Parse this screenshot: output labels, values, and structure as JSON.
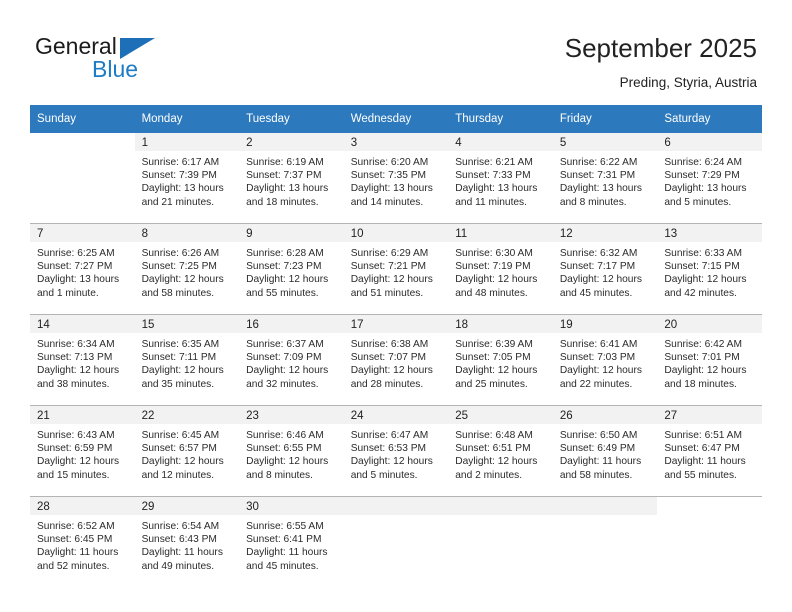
{
  "brand": {
    "name_top": "General",
    "name_bottom": "Blue",
    "triangle_color": "#1d6fb8",
    "blue_text_color": "#1d7cc4"
  },
  "header": {
    "title": "September 2025",
    "location": "Preding, Styria, Austria"
  },
  "theme": {
    "header_row_bg": "#2d79bd",
    "header_row_text": "#ffffff",
    "daynum_band_bg": "#f2f2f2",
    "cell_bg": "#ffffff",
    "row_divider": "#b4b4b4"
  },
  "weekday_headers": [
    "Sunday",
    "Monday",
    "Tuesday",
    "Wednesday",
    "Thursday",
    "Friday",
    "Saturday"
  ],
  "weeks": [
    [
      {
        "day": "",
        "sunrise": "",
        "sunset": "",
        "daylight_line1": "",
        "daylight_line2": ""
      },
      {
        "day": "1",
        "sunrise": "Sunrise: 6:17 AM",
        "sunset": "Sunset: 7:39 PM",
        "daylight_line1": "Daylight: 13 hours",
        "daylight_line2": "and 21 minutes."
      },
      {
        "day": "2",
        "sunrise": "Sunrise: 6:19 AM",
        "sunset": "Sunset: 7:37 PM",
        "daylight_line1": "Daylight: 13 hours",
        "daylight_line2": "and 18 minutes."
      },
      {
        "day": "3",
        "sunrise": "Sunrise: 6:20 AM",
        "sunset": "Sunset: 7:35 PM",
        "daylight_line1": "Daylight: 13 hours",
        "daylight_line2": "and 14 minutes."
      },
      {
        "day": "4",
        "sunrise": "Sunrise: 6:21 AM",
        "sunset": "Sunset: 7:33 PM",
        "daylight_line1": "Daylight: 13 hours",
        "daylight_line2": "and 11 minutes."
      },
      {
        "day": "5",
        "sunrise": "Sunrise: 6:22 AM",
        "sunset": "Sunset: 7:31 PM",
        "daylight_line1": "Daylight: 13 hours",
        "daylight_line2": "and 8 minutes."
      },
      {
        "day": "6",
        "sunrise": "Sunrise: 6:24 AM",
        "sunset": "Sunset: 7:29 PM",
        "daylight_line1": "Daylight: 13 hours",
        "daylight_line2": "and 5 minutes."
      }
    ],
    [
      {
        "day": "7",
        "sunrise": "Sunrise: 6:25 AM",
        "sunset": "Sunset: 7:27 PM",
        "daylight_line1": "Daylight: 13 hours",
        "daylight_line2": "and 1 minute."
      },
      {
        "day": "8",
        "sunrise": "Sunrise: 6:26 AM",
        "sunset": "Sunset: 7:25 PM",
        "daylight_line1": "Daylight: 12 hours",
        "daylight_line2": "and 58 minutes."
      },
      {
        "day": "9",
        "sunrise": "Sunrise: 6:28 AM",
        "sunset": "Sunset: 7:23 PM",
        "daylight_line1": "Daylight: 12 hours",
        "daylight_line2": "and 55 minutes."
      },
      {
        "day": "10",
        "sunrise": "Sunrise: 6:29 AM",
        "sunset": "Sunset: 7:21 PM",
        "daylight_line1": "Daylight: 12 hours",
        "daylight_line2": "and 51 minutes."
      },
      {
        "day": "11",
        "sunrise": "Sunrise: 6:30 AM",
        "sunset": "Sunset: 7:19 PM",
        "daylight_line1": "Daylight: 12 hours",
        "daylight_line2": "and 48 minutes."
      },
      {
        "day": "12",
        "sunrise": "Sunrise: 6:32 AM",
        "sunset": "Sunset: 7:17 PM",
        "daylight_line1": "Daylight: 12 hours",
        "daylight_line2": "and 45 minutes."
      },
      {
        "day": "13",
        "sunrise": "Sunrise: 6:33 AM",
        "sunset": "Sunset: 7:15 PM",
        "daylight_line1": "Daylight: 12 hours",
        "daylight_line2": "and 42 minutes."
      }
    ],
    [
      {
        "day": "14",
        "sunrise": "Sunrise: 6:34 AM",
        "sunset": "Sunset: 7:13 PM",
        "daylight_line1": "Daylight: 12 hours",
        "daylight_line2": "and 38 minutes."
      },
      {
        "day": "15",
        "sunrise": "Sunrise: 6:35 AM",
        "sunset": "Sunset: 7:11 PM",
        "daylight_line1": "Daylight: 12 hours",
        "daylight_line2": "and 35 minutes."
      },
      {
        "day": "16",
        "sunrise": "Sunrise: 6:37 AM",
        "sunset": "Sunset: 7:09 PM",
        "daylight_line1": "Daylight: 12 hours",
        "daylight_line2": "and 32 minutes."
      },
      {
        "day": "17",
        "sunrise": "Sunrise: 6:38 AM",
        "sunset": "Sunset: 7:07 PM",
        "daylight_line1": "Daylight: 12 hours",
        "daylight_line2": "and 28 minutes."
      },
      {
        "day": "18",
        "sunrise": "Sunrise: 6:39 AM",
        "sunset": "Sunset: 7:05 PM",
        "daylight_line1": "Daylight: 12 hours",
        "daylight_line2": "and 25 minutes."
      },
      {
        "day": "19",
        "sunrise": "Sunrise: 6:41 AM",
        "sunset": "Sunset: 7:03 PM",
        "daylight_line1": "Daylight: 12 hours",
        "daylight_line2": "and 22 minutes."
      },
      {
        "day": "20",
        "sunrise": "Sunrise: 6:42 AM",
        "sunset": "Sunset: 7:01 PM",
        "daylight_line1": "Daylight: 12 hours",
        "daylight_line2": "and 18 minutes."
      }
    ],
    [
      {
        "day": "21",
        "sunrise": "Sunrise: 6:43 AM",
        "sunset": "Sunset: 6:59 PM",
        "daylight_line1": "Daylight: 12 hours",
        "daylight_line2": "and 15 minutes."
      },
      {
        "day": "22",
        "sunrise": "Sunrise: 6:45 AM",
        "sunset": "Sunset: 6:57 PM",
        "daylight_line1": "Daylight: 12 hours",
        "daylight_line2": "and 12 minutes."
      },
      {
        "day": "23",
        "sunrise": "Sunrise: 6:46 AM",
        "sunset": "Sunset: 6:55 PM",
        "daylight_line1": "Daylight: 12 hours",
        "daylight_line2": "and 8 minutes."
      },
      {
        "day": "24",
        "sunrise": "Sunrise: 6:47 AM",
        "sunset": "Sunset: 6:53 PM",
        "daylight_line1": "Daylight: 12 hours",
        "daylight_line2": "and 5 minutes."
      },
      {
        "day": "25",
        "sunrise": "Sunrise: 6:48 AM",
        "sunset": "Sunset: 6:51 PM",
        "daylight_line1": "Daylight: 12 hours",
        "daylight_line2": "and 2 minutes."
      },
      {
        "day": "26",
        "sunrise": "Sunrise: 6:50 AM",
        "sunset": "Sunset: 6:49 PM",
        "daylight_line1": "Daylight: 11 hours",
        "daylight_line2": "and 58 minutes."
      },
      {
        "day": "27",
        "sunrise": "Sunrise: 6:51 AM",
        "sunset": "Sunset: 6:47 PM",
        "daylight_line1": "Daylight: 11 hours",
        "daylight_line2": "and 55 minutes."
      }
    ],
    [
      {
        "day": "28",
        "sunrise": "Sunrise: 6:52 AM",
        "sunset": "Sunset: 6:45 PM",
        "daylight_line1": "Daylight: 11 hours",
        "daylight_line2": "and 52 minutes."
      },
      {
        "day": "29",
        "sunrise": "Sunrise: 6:54 AM",
        "sunset": "Sunset: 6:43 PM",
        "daylight_line1": "Daylight: 11 hours",
        "daylight_line2": "and 49 minutes."
      },
      {
        "day": "30",
        "sunrise": "Sunrise: 6:55 AM",
        "sunset": "Sunset: 6:41 PM",
        "daylight_line1": "Daylight: 11 hours",
        "daylight_line2": "and 45 minutes."
      },
      {
        "day": "",
        "sunrise": "",
        "sunset": "",
        "daylight_line1": "",
        "daylight_line2": ""
      },
      {
        "day": "",
        "sunrise": "",
        "sunset": "",
        "daylight_line1": "",
        "daylight_line2": ""
      },
      {
        "day": "",
        "sunrise": "",
        "sunset": "",
        "daylight_line1": "",
        "daylight_line2": ""
      },
      {
        "day": "",
        "sunrise": "",
        "sunset": "",
        "daylight_line1": "",
        "daylight_line2": ""
      }
    ]
  ]
}
